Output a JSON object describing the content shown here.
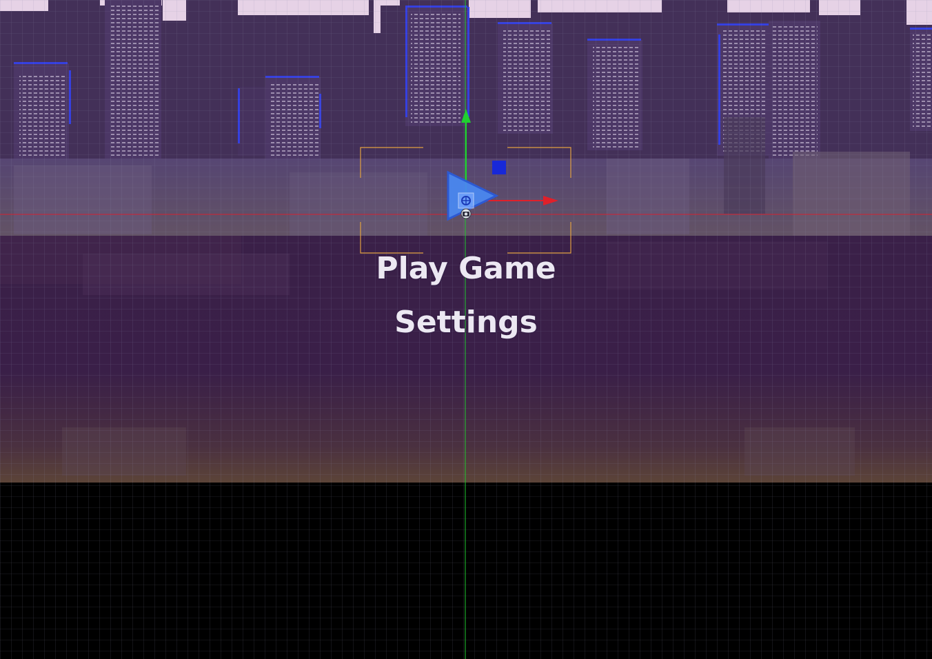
{
  "menu": {
    "play_label": "Play Game",
    "settings_label": "Settings"
  },
  "colors": {
    "sky": "#3d2a52",
    "skyline_back": "#4a3566",
    "buildings_front": "#5b4574",
    "ground_top": "#341c45",
    "ground_bottom": "#5a4038",
    "void": "#000000",
    "grid_line": "#7f7f9a",
    "x_axis": "#e0202a",
    "y_axis": "#20d030",
    "camera_frame": "#e0a040",
    "gizmo_blue": "#3a6cf0",
    "menu_text": "#ece8f2"
  },
  "editor": {
    "gizmos": [
      "move-x-arrow",
      "move-y-arrow",
      "camera-icon",
      "sprite-pivot-icon",
      "camera-bounds-frame"
    ]
  }
}
